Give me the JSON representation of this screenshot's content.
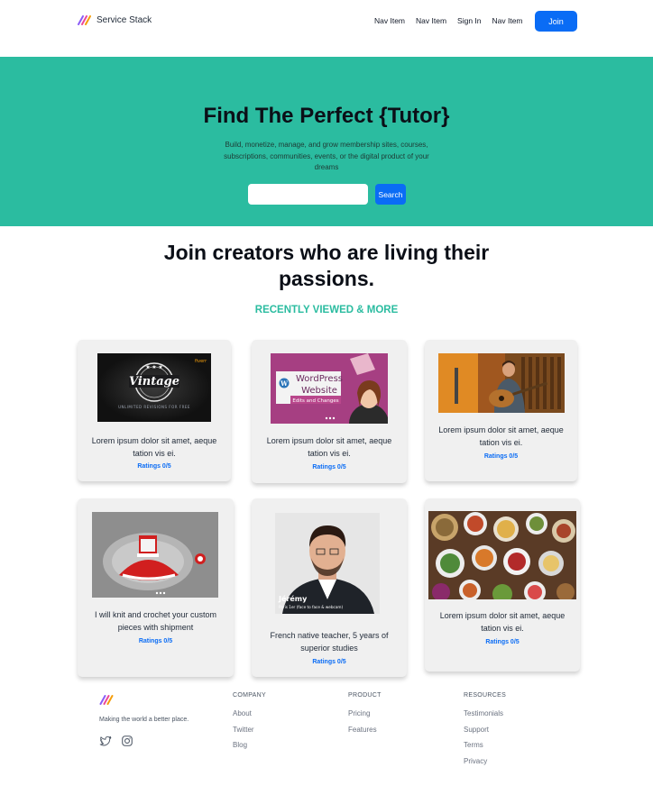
{
  "header": {
    "brand": "Service Stack",
    "nav": [
      "Nav Item",
      "Nav Item",
      "Sign In",
      "Nav Item"
    ],
    "join_label": "Join"
  },
  "hero": {
    "title": "Find The Perfect {Tutor}",
    "subtitle": "Build, monetize, manage, and grow membership sites, courses, subscriptions, communities, events, or the digital product of your dreams",
    "search_placeholder": "",
    "search_label": "Search",
    "bg_color": "#2bbca0"
  },
  "section": {
    "title": "Join creators who are living their passions.",
    "subtitle": "RECENTLY VIEWED & MORE"
  },
  "cards": [
    {
      "image": "vintage-logo-design",
      "text": "Lorem ipsum dolor sit amet, aeque tation vis ei.",
      "rating": "Ratings 0/5"
    },
    {
      "image": "wordpress-website-edits",
      "text": "Lorem ipsum dolor sit amet, aeque tation vis ei.",
      "rating": "Ratings 0/5"
    },
    {
      "image": "guitarist-playing",
      "text": "Lorem ipsum dolor sit amet, aeque tation vis ei.",
      "rating": "Ratings 0/5"
    },
    {
      "image": "crochet-dress",
      "text": "I will knit and crochet your custom pieces with shipment",
      "rating": "Ratings 0/5"
    },
    {
      "image": "tutor-portrait",
      "text": "French native teacher, 5 years of superior studies",
      "rating": "Ratings 0/5"
    },
    {
      "image": "food-table",
      "text": "Lorem ipsum dolor sit amet, aeque tation vis ei.",
      "rating": "Ratings 0/5"
    }
  ],
  "image_text": {
    "vintage_word": "Vintage",
    "vintage_banner": "UNLIMITED REVISIONS FOR FREE",
    "vintage_tag": "fiverr",
    "wp_line1": "WordPress",
    "wp_line2": "Website",
    "wp_line3": "Edits and Changes",
    "tutor_name": "Jérémy",
    "tutor_caption": "Paris 1er (face to face & webcam)"
  },
  "footer": {
    "tagline": "Making the world a better place.",
    "social": [
      "twitter-icon",
      "instagram-icon"
    ],
    "columns": [
      {
        "heading": "COMPANY",
        "links": [
          "About",
          "Twitter",
          "Blog"
        ]
      },
      {
        "heading": "PRODUCT",
        "links": [
          "Pricing",
          "Features"
        ]
      },
      {
        "heading": "RESOURCES",
        "links": [
          "Testimonials",
          "Support",
          "Terms",
          "Privacy"
        ]
      }
    ]
  },
  "colors": {
    "accent": "#0a6cf5",
    "teal": "#2bbca0"
  }
}
